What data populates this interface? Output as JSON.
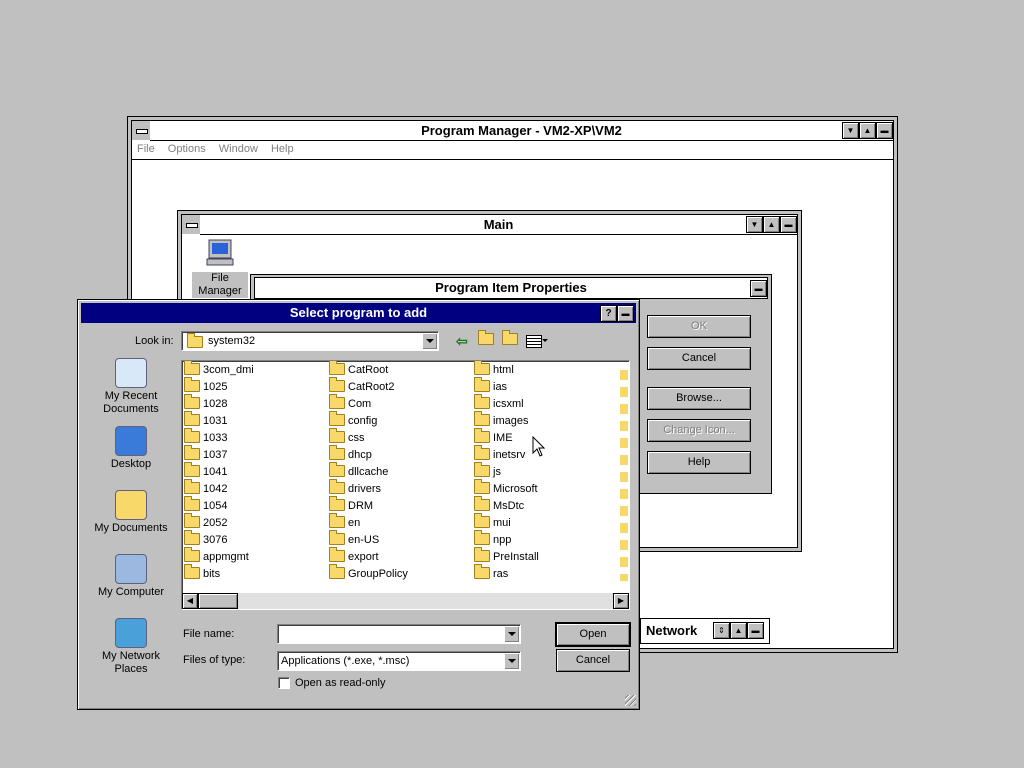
{
  "program_manager": {
    "title": "Program Manager - VM2-XP\\VM2",
    "menu": [
      "File",
      "Options",
      "Window",
      "Help"
    ]
  },
  "main_group": {
    "title": "Main",
    "icon_label_1": "File",
    "icon_label_2": "Manager"
  },
  "network_group": {
    "title": "Network"
  },
  "properties": {
    "title": "Program Item Properties",
    "buttons": {
      "ok": "OK",
      "cancel": "Cancel",
      "browse": "Browse...",
      "change_icon": "Change Icon...",
      "help": "Help"
    }
  },
  "dialog": {
    "title": "Select program to add",
    "look_in_label": "Look in:",
    "look_in_value": "system32",
    "places": [
      {
        "line1": "My Recent",
        "line2": "Documents",
        "icon": "recent-documents-icon"
      },
      {
        "line1": "Desktop",
        "line2": "",
        "icon": "desktop-icon"
      },
      {
        "line1": "My Documents",
        "line2": "",
        "icon": "my-documents-icon"
      },
      {
        "line1": "My Computer",
        "line2": "",
        "icon": "my-computer-icon"
      },
      {
        "line1": "My Network",
        "line2": "Places",
        "icon": "network-places-icon"
      }
    ],
    "files": {
      "col1": [
        "3com_dmi",
        "1025",
        "1028",
        "1031",
        "1033",
        "1037",
        "1041",
        "1042",
        "1054",
        "2052",
        "3076",
        "appmgmt",
        "bits"
      ],
      "col2": [
        "CatRoot",
        "CatRoot2",
        "Com",
        "config",
        "css",
        "dhcp",
        "dllcache",
        "drivers",
        "DRM",
        "en",
        "en-US",
        "export",
        "GroupPolicy"
      ],
      "col3": [
        "html",
        "ias",
        "icsxml",
        "images",
        "IME",
        "inetsrv",
        "js",
        "Microsoft",
        "MsDtc",
        "mui",
        "npp",
        "PreInstall",
        "ras"
      ]
    },
    "file_name_label": "File name:",
    "file_name_value": "",
    "files_of_type_label": "Files of type:",
    "files_of_type_value": "Applications (*.exe, *.msc)",
    "read_only_label": "Open as read-only",
    "read_only_checked": false,
    "open_button": "Open",
    "cancel_button": "Cancel"
  }
}
